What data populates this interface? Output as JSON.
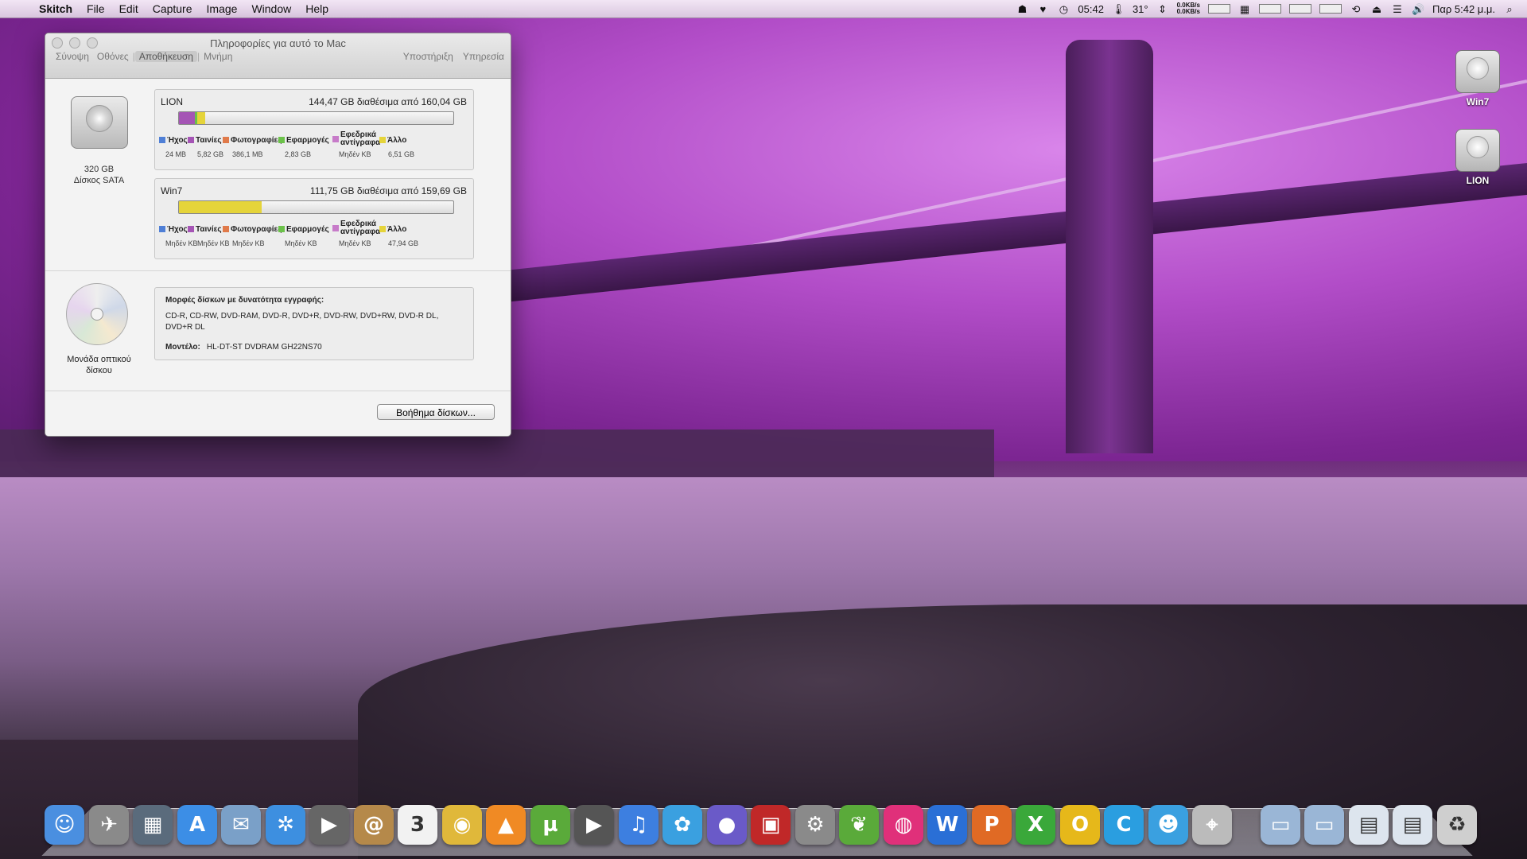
{
  "menubar": {
    "app": "Skitch",
    "items": [
      "File",
      "Edit",
      "Capture",
      "Image",
      "Window",
      "Help"
    ],
    "clock_small": "05:42",
    "temp": "31°",
    "net_up": "0.0KB/s",
    "net_down": "0.0KB/s",
    "datetime": "Παρ 5:42 μ.μ."
  },
  "window": {
    "title": "Πληροφορίες για αυτό το Mac",
    "tabs_left": [
      "Σύνοψη",
      "Οθόνες",
      "Αποθήκευση",
      "Μνήμη"
    ],
    "active_tab": "Αποθήκευση",
    "tabs_right": [
      "Υποστήριξη",
      "Υπηρεσία"
    ],
    "disk": {
      "line1": "320 GB",
      "line2": "Δίσκος SATA"
    },
    "volumes": [
      {
        "name": "LION",
        "free_text": "144,47 GB διαθέσιμα από 160,04 GB",
        "used_fraction": 0.097,
        "legend": [
          {
            "label": "Ήχος",
            "value": "24 MB",
            "color": "#4f7fd6"
          },
          {
            "label": "Ταινίες",
            "value": "5,82 GB",
            "color": "#a555b5"
          },
          {
            "label": "Φωτογραφίες",
            "value": "386,1 MB",
            "color": "#e07a4a"
          },
          {
            "label": "Εφαρμογές",
            "value": "2,83 GB",
            "color": "#6cc24a"
          },
          {
            "label1": "Εφεδρικά",
            "label2": "αντίγραφα",
            "value": "Μηδέν KB",
            "color": "#c77bc9"
          },
          {
            "label": "Άλλο",
            "value": "6,51 GB",
            "color": "#e5d43a"
          }
        ]
      },
      {
        "name": "Win7",
        "free_text": "111,75 GB διαθέσιμα από 159,69 GB",
        "used_fraction": 0.3,
        "legend": [
          {
            "label": "Ήχος",
            "value": "Μηδέν KB",
            "color": "#4f7fd6"
          },
          {
            "label": "Ταινίες",
            "value": "Μηδέν KB",
            "color": "#a555b5"
          },
          {
            "label": "Φωτογραφίες",
            "value": "Μηδέν KB",
            "color": "#e07a4a"
          },
          {
            "label": "Εφαρμογές",
            "value": "Μηδέν KB",
            "color": "#6cc24a"
          },
          {
            "label1": "Εφεδρικά",
            "label2": "αντίγραφα",
            "value": "Μηδέν KB",
            "color": "#c77bc9"
          },
          {
            "label": "Άλλο",
            "value": "47,94 GB",
            "color": "#e5d43a"
          }
        ]
      }
    ],
    "optical": {
      "caption1": "Μονάδα οπτικού",
      "caption2": "δίσκου",
      "heading": "Μορφές δίσκων με δυνατότητα εγγραφής:",
      "formats": "CD-R, CD-RW, DVD-RAM, DVD-R, DVD+R, DVD-RW, DVD+RW, DVD-R DL, DVD+R DL",
      "model_label": "Μοντέλο:",
      "model_value": "HL-DT-ST DVDRAM GH22NS70"
    },
    "help_button": "Βοήθημα δίσκων..."
  },
  "desktop": {
    "icons": [
      "Win7",
      "LION"
    ]
  },
  "dock": {
    "apps": [
      {
        "icon": "finder-icon",
        "color": "#4a8fe0",
        "glyph": "☺"
      },
      {
        "icon": "launchpad-icon",
        "color": "#8a8a8a",
        "glyph": "✈"
      },
      {
        "icon": "mission-control-icon",
        "color": "#5a6b7c",
        "glyph": "▦"
      },
      {
        "icon": "app-store-icon",
        "color": "#3c8ee6",
        "glyph": "A"
      },
      {
        "icon": "mail-icon",
        "color": "#7aa0c8",
        "glyph": "✉"
      },
      {
        "icon": "safari-icon",
        "color": "#3d8fe0",
        "glyph": "✲"
      },
      {
        "icon": "facetime-icon",
        "color": "#666",
        "glyph": "▶"
      },
      {
        "icon": "address-book-icon",
        "color": "#b5894a",
        "glyph": "@"
      },
      {
        "icon": "calendar-icon",
        "color": "#f2f2f2",
        "glyph": "3"
      },
      {
        "icon": "chrome-icon",
        "color": "#e0b83a",
        "glyph": "◉"
      },
      {
        "icon": "vlc-icon",
        "color": "#f08a24",
        "glyph": "▲"
      },
      {
        "icon": "utorrent-icon",
        "color": "#5aaa3a",
        "glyph": "µ"
      },
      {
        "icon": "dvd-player-icon",
        "color": "#555",
        "glyph": "▶"
      },
      {
        "icon": "itunes-icon",
        "color": "#3d7fe0",
        "glyph": "♫"
      },
      {
        "icon": "twitter-icon",
        "color": "#3aa0e0",
        "glyph": "✿"
      },
      {
        "icon": "stellarium-icon",
        "color": "#6a5ac8",
        "glyph": "●"
      },
      {
        "icon": "photo-booth-icon",
        "color": "#c02828",
        "glyph": "▣"
      },
      {
        "icon": "system-preferences-icon",
        "color": "#8a8a8a",
        "glyph": "⚙"
      },
      {
        "icon": "evernote-icon",
        "color": "#5aaa3a",
        "glyph": "❦"
      },
      {
        "icon": "pinkglobe-icon",
        "color": "#e0307a",
        "glyph": "◍"
      },
      {
        "icon": "word-icon",
        "color": "#2a6fd6",
        "glyph": "W"
      },
      {
        "icon": "powerpoint-icon",
        "color": "#e06a24",
        "glyph": "P"
      },
      {
        "icon": "excel-icon",
        "color": "#3aa83a",
        "glyph": "X"
      },
      {
        "icon": "outlook-icon",
        "color": "#e6b81a",
        "glyph": "O"
      },
      {
        "icon": "communicator-icon",
        "color": "#2a9ee0",
        "glyph": "C"
      },
      {
        "icon": "messenger-icon",
        "color": "#3aa0e0",
        "glyph": "☻"
      },
      {
        "icon": "compass-icon",
        "color": "#bbb",
        "glyph": "⌖"
      },
      {
        "icon": "applications-folder-icon",
        "color": "#9ab6d6",
        "glyph": "▭"
      },
      {
        "icon": "documents-folder-icon",
        "color": "#9ab6d6",
        "glyph": "▭"
      },
      {
        "icon": "downloads-stack-icon",
        "color": "#dde5ee",
        "glyph": "▤"
      },
      {
        "icon": "screenshot-stack-icon",
        "color": "#dde5ee",
        "glyph": "▤"
      },
      {
        "icon": "trash-icon",
        "color": "#cfcfcf",
        "glyph": "♻"
      }
    ]
  }
}
